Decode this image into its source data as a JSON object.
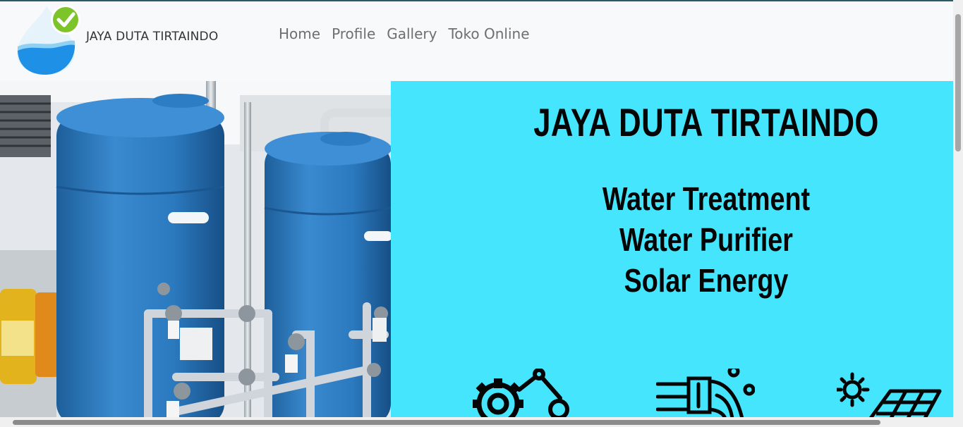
{
  "navbar": {
    "brand": "JAYA DUTA TIRTAINDO",
    "links": [
      "Home",
      "Profile",
      "Gallery",
      "Toko Online"
    ]
  },
  "hero": {
    "title": "JAYA DUTA TIRTAINDO",
    "services": [
      "Water Treatment",
      "Water Purifier",
      "Solar Energy"
    ],
    "panel_color": "#45e6fd"
  },
  "icons": {
    "logo": "water-drop-check-icon",
    "service_icons": [
      "gear-robot-arm-icon",
      "water-pipe-flow-icon",
      "solar-panel-icon"
    ]
  }
}
